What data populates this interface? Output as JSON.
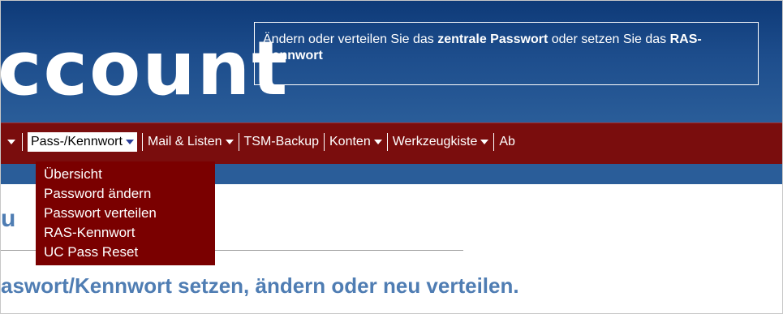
{
  "header": {
    "logo_text": "ccount",
    "info": {
      "part1": "Ändern oder verteilen Sie das ",
      "bold1": "zentrale Passwort",
      "part2": " oder setzen Sie das ",
      "bold2": "RAS-Kennwort"
    }
  },
  "nav": {
    "items": [
      {
        "label": "Pass-/Kennwort",
        "active": true,
        "dropdown": true
      },
      {
        "label": "Mail & Listen",
        "dropdown": true
      },
      {
        "label": "TSM-Backup",
        "dropdown": false
      },
      {
        "label": "Konten",
        "dropdown": true
      },
      {
        "label": "Werkzeugkiste",
        "dropdown": true
      },
      {
        "label": "Ab",
        "dropdown": false
      }
    ]
  },
  "dropdown": {
    "items": [
      "Übersicht",
      "Password ändern",
      "Passwort verteilen",
      "RAS-Kennwort",
      "UC Pass Reset"
    ]
  },
  "content": {
    "heading": "u",
    "subtitle_partial": "aswort/Kennwort setzen, ändern oder neu verteilen."
  },
  "colors": {
    "header_blue": "#1d4d8c",
    "nav_red": "#7a0d0d",
    "dropdown_red": "#7a0000",
    "heading_blue": "#4f7db3"
  }
}
